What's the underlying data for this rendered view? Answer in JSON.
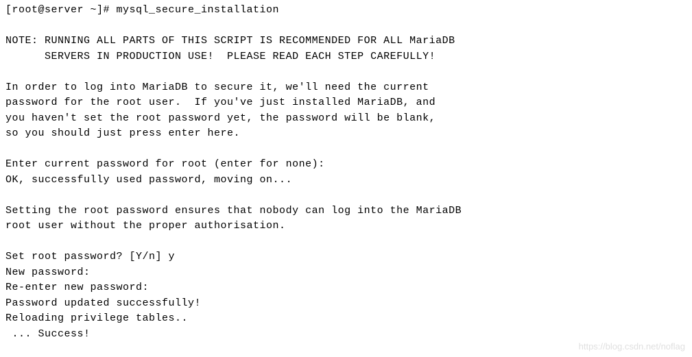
{
  "terminal": {
    "prompt_line": "[root@server ~]# mysql_secure_installation",
    "blank1": "",
    "note_line1": "NOTE: RUNNING ALL PARTS OF THIS SCRIPT IS RECOMMENDED FOR ALL MariaDB",
    "note_line2": "      SERVERS IN PRODUCTION USE!  PLEASE READ EACH STEP CAREFULLY!",
    "blank2": "",
    "intro_line1": "In order to log into MariaDB to secure it, we'll need the current",
    "intro_line2": "password for the root user.  If you've just installed MariaDB, and",
    "intro_line3": "you haven't set the root password yet, the password will be blank,",
    "intro_line4": "so you should just press enter here.",
    "blank3": "",
    "enter_pass": "Enter current password for root (enter for none):",
    "ok_line": "OK, successfully used password, moving on...",
    "blank4": "",
    "setting_line1": "Setting the root password ensures that nobody can log into the MariaDB",
    "setting_line2": "root user without the proper authorisation.",
    "blank5": "",
    "set_root": "Set root password? [Y/n] y",
    "new_pass": "New password:",
    "reenter": "Re-enter new password:",
    "updated": "Password updated successfully!",
    "reloading": "Reloading privilege tables..",
    "success": " ... Success!"
  },
  "watermark": "https://blog.csdn.net/noflag"
}
